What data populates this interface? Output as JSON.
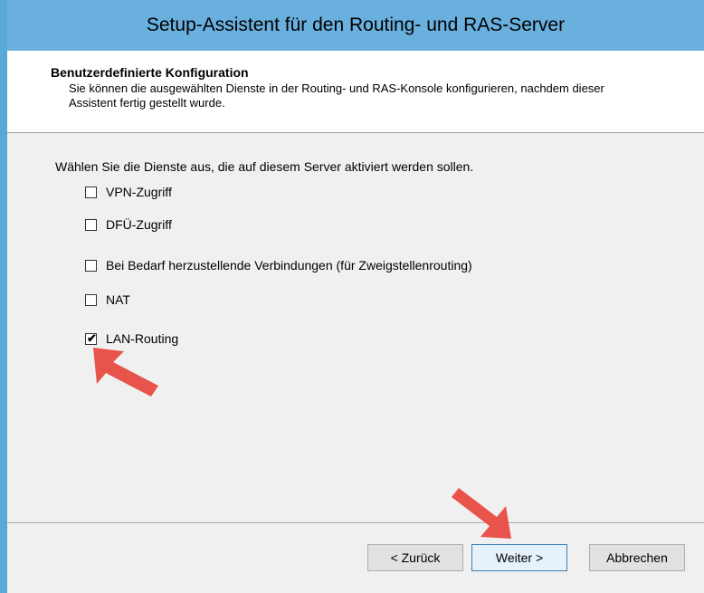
{
  "window": {
    "title": "Setup-Assistent für den Routing- und RAS-Server"
  },
  "header": {
    "title": "Benutzerdefinierte Konfiguration",
    "description": "Sie können die ausgewählten Dienste in der Routing- und RAS-Konsole konfigurieren, nachdem dieser Assistent fertig gestellt wurde."
  },
  "content": {
    "instruction": "Wählen Sie die Dienste aus, die auf diesem Server aktiviert werden sollen.",
    "options": [
      {
        "label": "VPN-Zugriff",
        "checked": false
      },
      {
        "label": "DFÜ-Zugriff",
        "checked": false
      },
      {
        "label": "Bei Bedarf herzustellende Verbindungen (für Zweigstellenrouting)",
        "checked": false
      },
      {
        "label": "NAT",
        "checked": false
      },
      {
        "label": "LAN-Routing",
        "checked": true
      }
    ]
  },
  "buttons": {
    "back": "< Zurück",
    "next": "Weiter >",
    "cancel": "Abbrechen"
  },
  "annotations": {
    "arrow_color": "#e8534b"
  }
}
